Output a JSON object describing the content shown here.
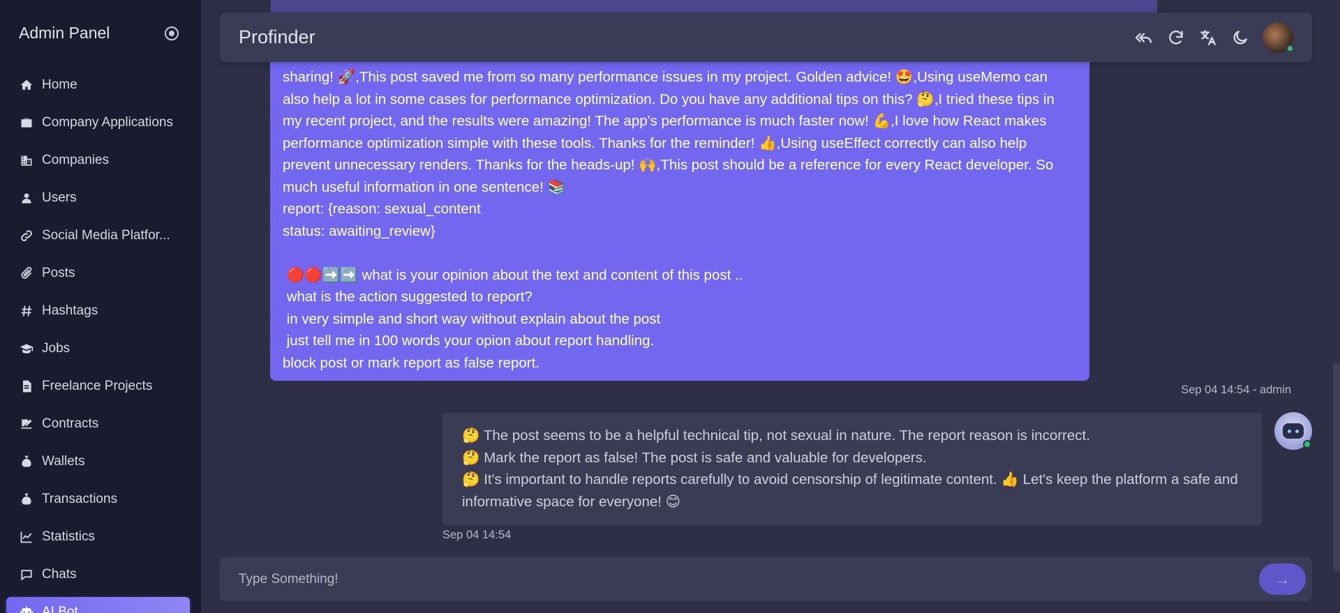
{
  "sidebar": {
    "title": "Admin Panel",
    "items": [
      {
        "label": "Home",
        "icon": "home-icon"
      },
      {
        "label": "Company Applications",
        "icon": "briefcase-icon"
      },
      {
        "label": "Companies",
        "icon": "building-icon"
      },
      {
        "label": "Users",
        "icon": "user-icon"
      },
      {
        "label": "Social Media Platfor...",
        "icon": "link-icon"
      },
      {
        "label": "Posts",
        "icon": "paperclip-icon"
      },
      {
        "label": "Hashtags",
        "icon": "hashtag-icon"
      },
      {
        "label": "Jobs",
        "icon": "graduation-cap-icon"
      },
      {
        "label": "Freelance Projects",
        "icon": "file-icon"
      },
      {
        "label": "Contracts",
        "icon": "signature-icon"
      },
      {
        "label": "Wallets",
        "icon": "money-bag-icon"
      },
      {
        "label": "Transactions",
        "icon": "money-bag-icon"
      },
      {
        "label": "Statistics",
        "icon": "chart-line-icon"
      },
      {
        "label": "Chats",
        "icon": "chat-icon"
      },
      {
        "label": "AI Bot",
        "icon": "robot-icon",
        "active": true
      }
    ]
  },
  "header": {
    "title": "Profinder"
  },
  "chat": {
    "admin_message": "sharing! 🚀,This post saved me from so many performance issues in my project. Golden advice! 🤩,Using useMemo can also help a lot in some cases for performance optimization. Do you have any additional tips on this? 🤔,I tried these tips in my recent project, and the results were amazing! The app's performance is much faster now! 💪,I love how React makes performance optimization simple with these tools. Thanks for the reminder! 👍,Using useEffect correctly can also help prevent unnecessary renders. Thanks for the heads-up! 🙌,This post should be a reference for every React developer. So much useful information in one sentence! 📚\nreport: {reason: sexual_content\nstatus: awaiting_review}\n\n 🔴🔴➡️➡️ what is your opinion about the text and content of this post ..\n what is the action suggested to report?\n in very simple and short way without explain about the post\n just tell me in 100 words your opion about report handling.\nblock post or mark report as false report.",
    "admin_meta": "Sep 04 14:54 - admin",
    "bot_message": "🤔 The post seems to be a helpful technical tip, not sexual in nature. The report reason is incorrect.\n🤔 Mark the report as false! The post is safe and valuable for developers.\n🤔 It's important to handle reports carefully to avoid censorship of legitimate content. 👍 Let's keep the platform a safe and informative space for everyone! 😊",
    "bot_meta": "Sep 04 14:54"
  },
  "input": {
    "placeholder": "Type Something!"
  },
  "colors": {
    "accent": "#7367f0",
    "sidebar_bg": "#1a1b2e",
    "content_bg": "#2e2f46",
    "card_bg": "#3a3b54",
    "online": "#28c76f"
  }
}
